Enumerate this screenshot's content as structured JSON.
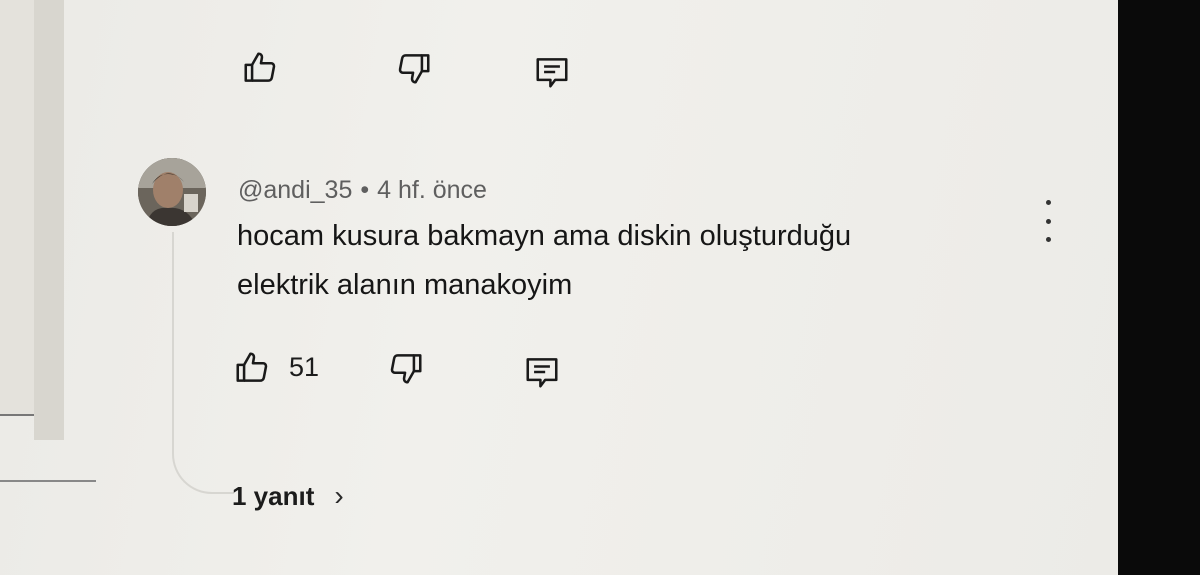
{
  "top_actions": {
    "like_icon": "thumbs-up-icon",
    "dislike_icon": "thumbs-down-icon",
    "reply_icon": "comment-icon"
  },
  "comment": {
    "author": "@andi_35",
    "separator": "•",
    "time": "4 hf. önce",
    "text_line1": "hocam kusura bakmayn ama diskin oluşturduğu",
    "text_line2": "elektrik alanın manakoyim",
    "like_count": "51",
    "replies_label": "1 yanıt",
    "replies_chevron": "›"
  }
}
